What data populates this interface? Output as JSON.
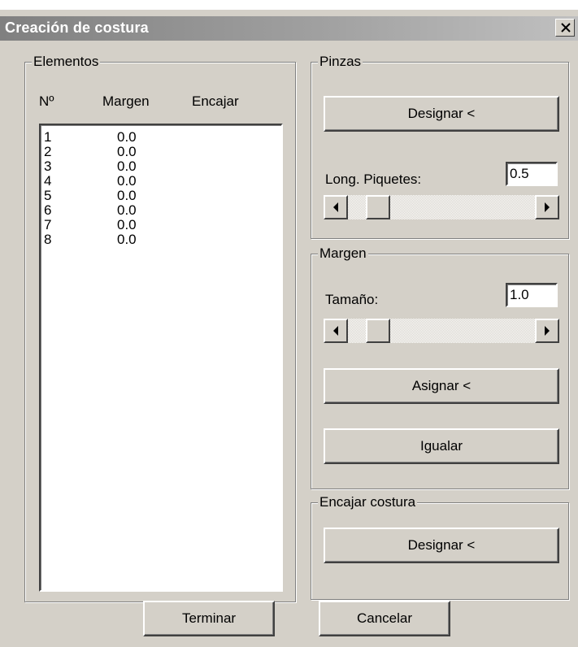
{
  "window": {
    "title": "Creación de costura",
    "close_label": "×"
  },
  "elements_group": {
    "label": "Elementos",
    "columns": [
      "Nº",
      "Margen",
      "Encajar"
    ],
    "rows": [
      {
        "num": "1",
        "margen": "0.0",
        "encajar": ""
      },
      {
        "num": "2",
        "margen": "0.0",
        "encajar": ""
      },
      {
        "num": "3",
        "margen": "0.0",
        "encajar": ""
      },
      {
        "num": "4",
        "margen": "0.0",
        "encajar": ""
      },
      {
        "num": "5",
        "margen": "0.0",
        "encajar": ""
      },
      {
        "num": "6",
        "margen": "0.0",
        "encajar": ""
      },
      {
        "num": "7",
        "margen": "0.0",
        "encajar": ""
      },
      {
        "num": "8",
        "margen": "0.0",
        "encajar": ""
      }
    ]
  },
  "pinzas_group": {
    "label": "Pinzas",
    "designar_label": "Designar <",
    "long_label": "Long. Piquetes:",
    "long_value": "0.5"
  },
  "margen_group": {
    "label": "Margen",
    "size_label": "Tamaño:",
    "size_value": "1.0",
    "asignar_label": "Asignar <",
    "igualar_label": "Igualar"
  },
  "encajar_group": {
    "label": "Encajar costura",
    "designar_label": "Designar <"
  },
  "footer": {
    "terminar_label": "Terminar",
    "cancelar_label": "Cancelar"
  },
  "colors": {
    "face": "#d4d0c8",
    "title_gradient_start": "#808080",
    "title_gradient_end": "#c0c0c0"
  },
  "icons": {
    "close": "close-icon",
    "scroll_left": "arrow-left-icon",
    "scroll_right": "arrow-right-icon"
  }
}
